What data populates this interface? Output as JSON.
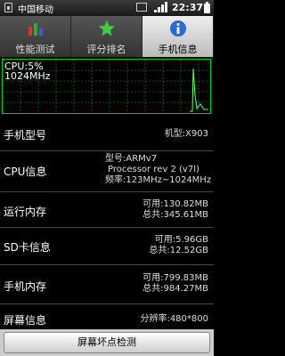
{
  "statusbar": {
    "carrier": "中国移动",
    "time": "22:37"
  },
  "tabs": [
    {
      "label": "性能测试",
      "icon": "bar-chart-icon"
    },
    {
      "label": "评分排名",
      "icon": "star-icon"
    },
    {
      "label": "手机信息",
      "icon": "info-icon",
      "active": true
    }
  ],
  "graph": {
    "cpu": "CPU:5%",
    "freq": "1024MHz"
  },
  "rows": {
    "model": {
      "label": "手机型号",
      "value": "机型:X903"
    },
    "cpu": {
      "label": "CPU信息",
      "lines": [
        "型号:ARMv7",
        "Processor rev 2 (v7l)",
        "频率:123MHz~1024MHz"
      ]
    },
    "ram": {
      "label": "运行内存",
      "lines": [
        "可用:130.82MB",
        "总共:345.61MB"
      ]
    },
    "sd": {
      "label": "SD卡信息",
      "lines": [
        "可用:5.96GB",
        "总共:12.52GB"
      ]
    },
    "rom": {
      "label": "手机内存",
      "lines": [
        "可用:799.83MB",
        "总共:984.27MB"
      ]
    },
    "screen": {
      "label": "屏幕信息",
      "value": "分辨率:480*800"
    }
  },
  "button": {
    "label": "屏幕坏点检测"
  }
}
